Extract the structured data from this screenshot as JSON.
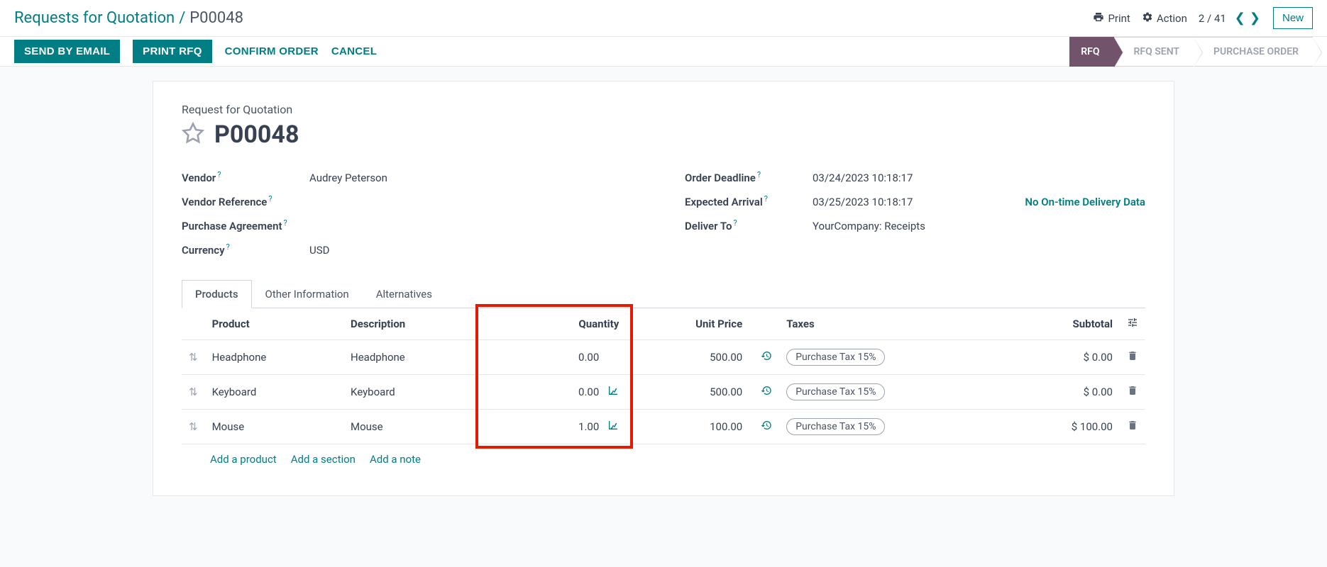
{
  "breadcrumb": {
    "root": "Requests for Quotation",
    "current": "P00048"
  },
  "topbar": {
    "print": "Print",
    "action": "Action",
    "page": "2 / 41",
    "new": "New"
  },
  "actions": {
    "send_email": "Send by Email",
    "print_rfq": "Print RFQ",
    "confirm": "Confirm Order",
    "cancel": "Cancel"
  },
  "status": {
    "rfq": "RFQ",
    "rfq_sent": "RFQ Sent",
    "po": "Purchase Order"
  },
  "card": {
    "subtitle": "Request for Quotation",
    "title": "P00048"
  },
  "fields": {
    "vendor_label": "Vendor",
    "vendor_value": "Audrey Peterson",
    "vendor_ref_label": "Vendor Reference",
    "vendor_ref_value": "",
    "agreement_label": "Purchase Agreement",
    "agreement_value": "",
    "currency_label": "Currency",
    "currency_value": "USD",
    "deadline_label": "Order Deadline",
    "deadline_value": "03/24/2023 10:18:17",
    "arrival_label": "Expected Arrival",
    "arrival_value": "03/25/2023 10:18:17",
    "no_data": "No On-time Delivery Data",
    "deliver_label": "Deliver To",
    "deliver_value": "YourCompany: Receipts"
  },
  "tabs": {
    "products": "Products",
    "other": "Other Information",
    "alt": "Alternatives"
  },
  "table": {
    "headers": {
      "product": "Product",
      "description": "Description",
      "quantity": "Quantity",
      "unit_price": "Unit Price",
      "taxes": "Taxes",
      "subtotal": "Subtotal"
    },
    "rows": [
      {
        "product": "Headphone",
        "description": "Headphone",
        "quantity": "0.00",
        "has_forecast": false,
        "unit_price": "500.00",
        "tax": "Purchase Tax 15%",
        "subtotal": "$ 0.00"
      },
      {
        "product": "Keyboard",
        "description": "Keyboard",
        "quantity": "0.00",
        "has_forecast": true,
        "unit_price": "500.00",
        "tax": "Purchase Tax 15%",
        "subtotal": "$ 0.00"
      },
      {
        "product": "Mouse",
        "description": "Mouse",
        "quantity": "1.00",
        "has_forecast": true,
        "unit_price": "100.00",
        "tax": "Purchase Tax 15%",
        "subtotal": "$ 100.00"
      }
    ]
  },
  "add_links": {
    "product": "Add a product",
    "section": "Add a section",
    "note": "Add a note"
  }
}
